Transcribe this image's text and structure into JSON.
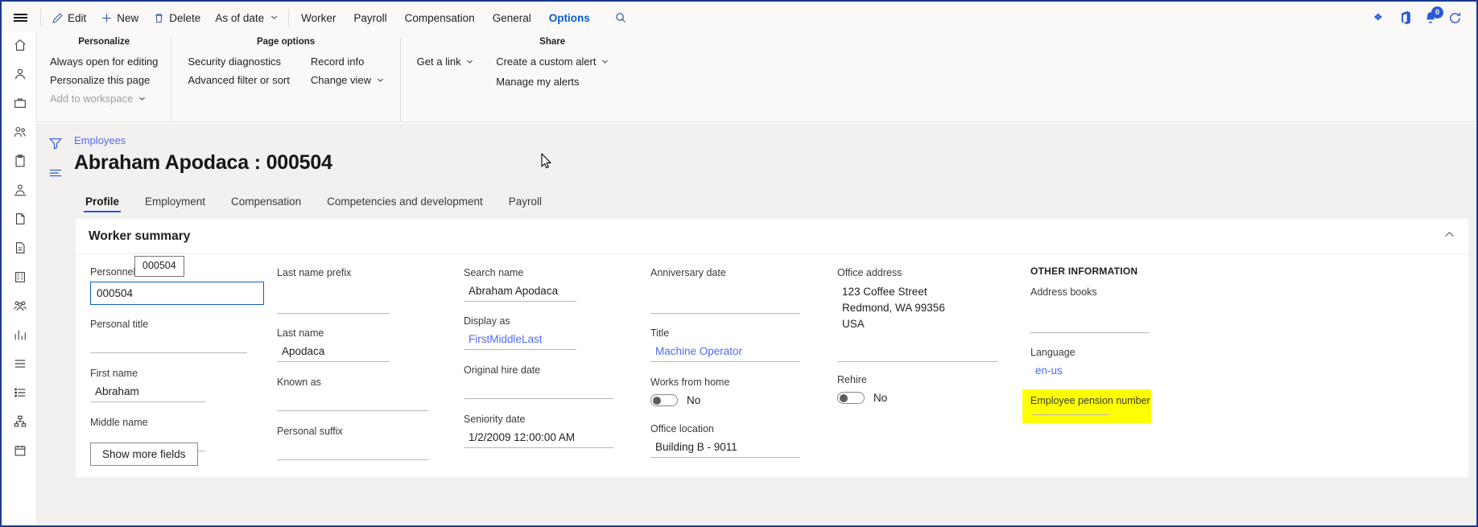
{
  "topbar": {
    "menu_icon": "hamburger-icon",
    "buttons": [
      {
        "label": "Edit",
        "icon": "pencil-icon"
      },
      {
        "label": "New",
        "icon": "plus-icon"
      },
      {
        "label": "Delete",
        "icon": "trash-icon"
      },
      {
        "label": "As of date",
        "icon": "chevron-down-icon",
        "has_caret": true
      }
    ],
    "tabs": [
      {
        "label": "Worker",
        "active": false
      },
      {
        "label": "Payroll",
        "active": false
      },
      {
        "label": "Compensation",
        "active": false
      },
      {
        "label": "General",
        "active": false
      },
      {
        "label": "Options",
        "active": true
      }
    ],
    "search_icon": "search-icon",
    "right_icons": [
      {
        "name": "dynamics-icon"
      },
      {
        "name": "office-app-launcher-icon"
      },
      {
        "name": "notifications-icon",
        "badge": "0"
      },
      {
        "name": "refresh-icon"
      }
    ]
  },
  "ribbon": {
    "groups": [
      {
        "title": "Personalize",
        "columns": [
          [
            {
              "label": "Always open for editing",
              "disabled": false
            },
            {
              "label": "Personalize this page",
              "disabled": false
            },
            {
              "label": "Add to workspace",
              "disabled": true,
              "caret": true
            }
          ]
        ]
      },
      {
        "title": "Page options",
        "columns": [
          [
            {
              "label": "Security diagnostics",
              "disabled": false
            },
            {
              "label": "Advanced filter or sort",
              "disabled": false
            }
          ],
          [
            {
              "label": "Record info",
              "disabled": false
            },
            {
              "label": "Change view",
              "disabled": false,
              "caret": true
            }
          ]
        ]
      },
      {
        "title": "",
        "columns": [
          [
            {
              "label": "Get a link",
              "disabled": false,
              "caret": true
            }
          ]
        ]
      },
      {
        "title": "Share",
        "columns": [
          [
            {
              "label": "Create a custom alert",
              "disabled": false,
              "caret": true
            },
            {
              "label": "Manage my alerts",
              "disabled": false
            }
          ]
        ]
      }
    ]
  },
  "page": {
    "breadcrumb": "Employees",
    "title": "Abraham Apodaca : 000504",
    "tabs": [
      {
        "label": "Profile",
        "active": true
      },
      {
        "label": "Employment",
        "active": false
      },
      {
        "label": "Compensation",
        "active": false
      },
      {
        "label": "Competencies and development",
        "active": false
      },
      {
        "label": "Payroll",
        "active": false
      }
    ]
  },
  "card": {
    "title": "Worker summary",
    "collapse_icon": "chevron-up-icon",
    "show_more_label": "Show more fields",
    "tooltip": "000504",
    "columns": {
      "col1": [
        {
          "label": "Personnel",
          "value": "000504",
          "type": "input"
        },
        {
          "label": "Personal title",
          "value": "",
          "type": "text"
        },
        {
          "label": "First name",
          "value": "Abraham",
          "type": "text"
        },
        {
          "label": "Middle name",
          "value": "",
          "type": "text"
        }
      ],
      "col2": [
        {
          "label": "Last name prefix",
          "value": "",
          "type": "text"
        },
        {
          "label": "Last name",
          "value": "Apodaca",
          "type": "text"
        },
        {
          "label": "Known as",
          "value": "",
          "type": "text"
        },
        {
          "label": "Personal suffix",
          "value": "",
          "type": "text"
        }
      ],
      "col3": [
        {
          "label": "Search name",
          "value": "Abraham Apodaca",
          "type": "text"
        },
        {
          "label": "Display as",
          "value": "FirstMiddleLast",
          "type": "link"
        },
        {
          "label": "Original hire date",
          "value": "",
          "type": "text"
        },
        {
          "label": "Seniority date",
          "value": "1/2/2009 12:00:00 AM",
          "type": "text"
        }
      ],
      "col4": [
        {
          "label": "Anniversary date",
          "value": "",
          "type": "text"
        },
        {
          "label": "Title",
          "value": "Machine Operator",
          "type": "link"
        },
        {
          "label": "Works from home",
          "value": "No",
          "type": "toggle"
        },
        {
          "label": "Office location",
          "value": "Building B - 9011",
          "type": "text"
        }
      ],
      "col5": [
        {
          "label": "Office address",
          "value": "",
          "type": "address",
          "lines": [
            "123 Coffee Street",
            "Redmond, WA 99356",
            "USA"
          ]
        },
        {
          "label": "Rehire",
          "value": "No",
          "type": "toggle"
        }
      ],
      "col6": {
        "header": "OTHER INFORMATION",
        "fields": [
          {
            "label": "Address books",
            "value": "",
            "type": "text"
          },
          {
            "label": "Language",
            "value": "en-us",
            "type": "link"
          },
          {
            "label": "Employee pension number",
            "value": "",
            "type": "text",
            "highlighted": true
          }
        ]
      }
    }
  },
  "left_rail": {
    "items": [
      {
        "name": "home-icon"
      },
      {
        "name": "person-icon"
      },
      {
        "name": "briefcase-icon"
      },
      {
        "name": "people-icon"
      },
      {
        "name": "clipboard-icon"
      },
      {
        "name": "person-badge-icon"
      },
      {
        "name": "page-icon"
      },
      {
        "name": "page-alt-icon"
      },
      {
        "name": "building-icon"
      },
      {
        "name": "people-group-icon"
      },
      {
        "name": "chart-icon"
      },
      {
        "name": "list-icon"
      },
      {
        "name": "list-alt-icon"
      },
      {
        "name": "org-chart-icon"
      },
      {
        "name": "calendar-icon"
      }
    ]
  },
  "content_rail": {
    "items": [
      {
        "name": "filter-icon"
      },
      {
        "name": "lines-icon"
      }
    ]
  },
  "colors": {
    "accent": "#2a58d8",
    "link": "#4f6bed",
    "highlight": "#ffff00",
    "window_border": "#1b3a8f",
    "chrome_bg": "#faf9f8",
    "content_bg": "#f2f1f0"
  }
}
